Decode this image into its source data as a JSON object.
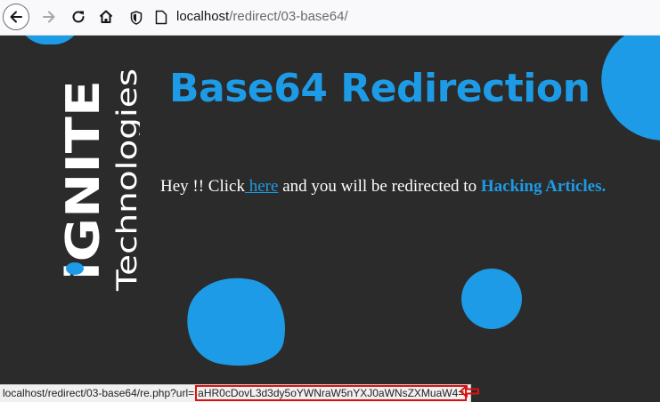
{
  "browser": {
    "url_host": "localhost",
    "url_path": "/redirect/03-base64/"
  },
  "page": {
    "logo_brand": "iGNITE",
    "logo_tagline": "Technologies",
    "headline": "Base64 Redirection !!",
    "message": {
      "prefix": "Hey !! Click",
      "link_text": " here",
      "middle": " and you will be redirected to ",
      "target_text": "Hacking Articles."
    }
  },
  "status_bar": {
    "url_prefix": "localhost/redirect/03-base64/re.php?url=",
    "encoded_value": "aHR0cDovL3d3dy5oYWNraW5nYXJ0aWNsZXMuaW4="
  },
  "colors": {
    "accent": "#1d9be6",
    "page_bg": "#2b2b2b",
    "annotation_red": "#e01010"
  }
}
